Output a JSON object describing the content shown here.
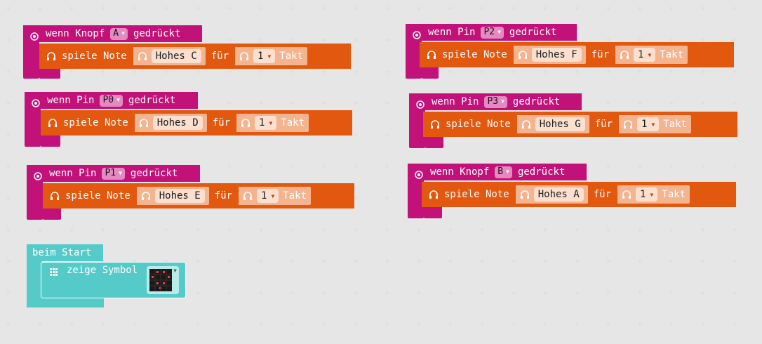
{
  "colors": {
    "event_block": "#c2127a",
    "music_block": "#e2580e",
    "slot_bg": "#f4b48f",
    "start_block": "#55cbc9",
    "grid_plus": "#dcdcdc"
  },
  "events": [
    {
      "prefix": "wenn Knopf",
      "selector": "A",
      "suffix": "gedrückt",
      "play": "spiele Note",
      "note": "Hohes C",
      "for": "für",
      "beats": "1",
      "unit": "Takt"
    },
    {
      "prefix": "wenn Pin",
      "selector": "P0",
      "suffix": "gedrückt",
      "play": "spiele Note",
      "note": "Hohes D",
      "for": "für",
      "beats": "1",
      "unit": "Takt"
    },
    {
      "prefix": "wenn Pin",
      "selector": "P1",
      "suffix": "gedrückt",
      "play": "spiele Note",
      "note": "Hohes E",
      "for": "für",
      "beats": "1",
      "unit": "Takt"
    },
    {
      "prefix": "wenn Pin",
      "selector": "P2",
      "suffix": "gedrückt",
      "play": "spiele Note",
      "note": "Hohes F",
      "for": "für",
      "beats": "1",
      "unit": "Takt"
    },
    {
      "prefix": "wenn Pin",
      "selector": "P3",
      "suffix": "gedrückt",
      "play": "spiele Note",
      "note": "Hohes G",
      "for": "für",
      "beats": "1",
      "unit": "Takt"
    },
    {
      "prefix": "wenn Knopf",
      "selector": "B",
      "suffix": "gedrückt",
      "play": "spiele Note",
      "note": "Hohes A",
      "for": "für",
      "beats": "1",
      "unit": "Takt"
    }
  ],
  "start": {
    "label": "beim Start",
    "action": "zeige Symbol"
  },
  "icons": {
    "event": "target-icon",
    "music": "headphones-icon",
    "grid": "led-grid-icon",
    "dropdown": "dropdown-arrow-icon"
  }
}
